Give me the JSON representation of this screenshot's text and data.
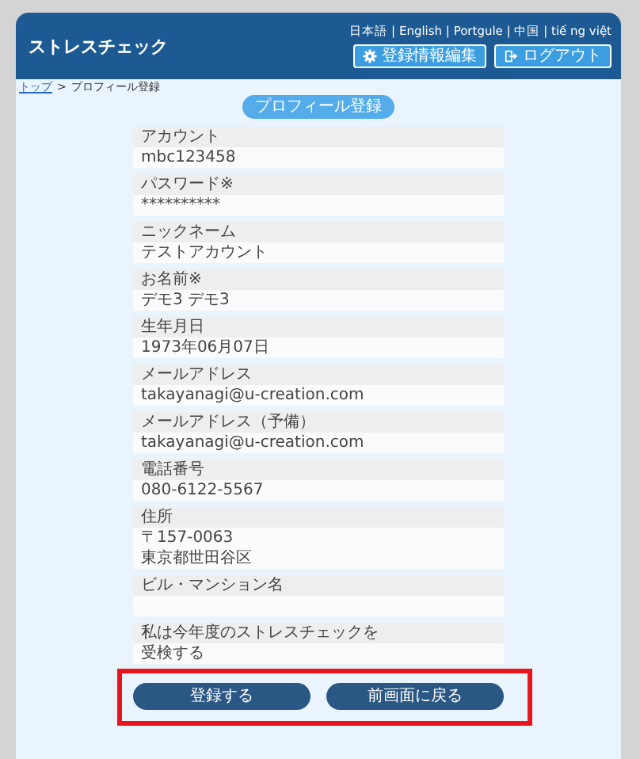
{
  "header": {
    "title": "ストレスチェック",
    "languages": "日本語 | English | Portgule | 中国 | tiế ng việt",
    "buttons": [
      {
        "label": "登録情報編集",
        "kind": "settings"
      },
      {
        "label": "ログアウト",
        "kind": "logout"
      }
    ]
  },
  "breadcrumb": {
    "link": "トップ",
    "separator": ">",
    "current": "プロフィール登録"
  },
  "page_title": "プロフィール登録",
  "fields": [
    {
      "label": "アカウント",
      "values": [
        "mbc123458"
      ]
    },
    {
      "label": "パスワード※",
      "values": [
        "**********"
      ]
    },
    {
      "label": "ニックネーム",
      "values": [
        "テストアカウント"
      ]
    },
    {
      "label": "お名前※",
      "values": [
        "デモ3 デモ3"
      ]
    },
    {
      "label": "生年月日",
      "values": [
        "1973年06月07日"
      ]
    },
    {
      "label": "メールアドレス",
      "values": [
        "takayanagi@u-creation.com"
      ]
    },
    {
      "label": "メールアドレス（予備）",
      "values": [
        "takayanagi@u-creation.com"
      ]
    },
    {
      "label": "電話番号",
      "values": [
        "080-6122-5567"
      ]
    },
    {
      "label": "住所",
      "values": [
        "〒157-0063",
        "東京都世田谷区"
      ]
    },
    {
      "label": "ビル・マンション名"
    },
    {
      "label": "私は今年度のストレスチェックを",
      "values": [
        "受検する"
      ]
    }
  ],
  "buttons": [
    "登録する",
    "前画面に戻る"
  ]
}
